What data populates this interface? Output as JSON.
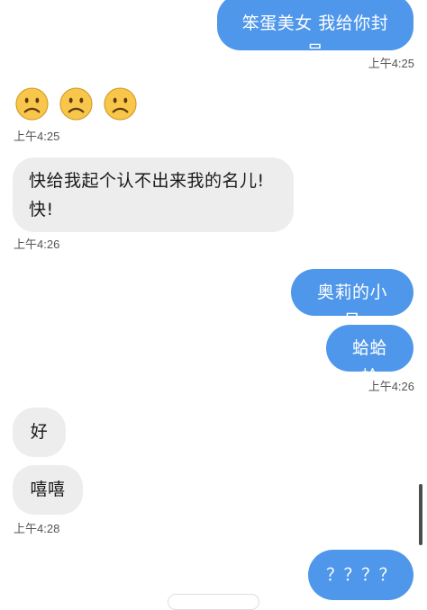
{
  "messages": {
    "m1": {
      "text": "笨蛋美女 我给你封号",
      "time": "上午4:25"
    },
    "m2": {
      "time": "上午4:25",
      "emojis": [
        "frowning-face",
        "frowning-face",
        "frowning-face"
      ]
    },
    "m3": {
      "line1": "快给我起个认不出来我的名儿!",
      "line2": "快!",
      "time": "上午4:26"
    },
    "m4": {
      "text": "奥莉的小号"
    },
    "m5": {
      "text": "蛤蛤蛤",
      "time": "上午4:26"
    },
    "m6": {
      "text": "好"
    },
    "m7": {
      "text": "嘻嘻",
      "time": "上午4:28"
    },
    "m8": {
      "text": "？？？？"
    }
  },
  "colors": {
    "outgoing_bubble": "#4f97ea",
    "incoming_bubble": "#ededed",
    "emoji_face": "#f7c64a"
  }
}
